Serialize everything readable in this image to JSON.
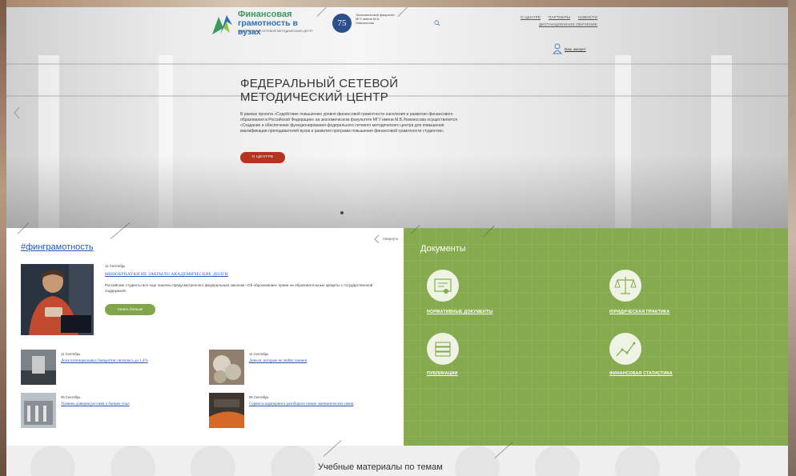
{
  "header": {
    "logo_title_line1": "Финансовая",
    "logo_title_line2": "грамотность в вузах",
    "logo_subtitle": "ФЕДЕРАЛЬНЫЙ СЕТЕВОЙ МЕТОДИЧЕСКИЙ ЦЕНТР",
    "badge_number": "75",
    "badge_text": "Экономический факультет МГУ имени М.В. Ломоносова",
    "nav": [
      "О ЦЕНТРЕ",
      "ПАРТНЕРЫ",
      "НОВОСТИ",
      "ДИСТАНЦИОННОЕ ОБУЧЕНИЕ"
    ],
    "account_label": "Ваш аккаунт"
  },
  "hero": {
    "title_line1": "ФЕДЕРАЛЬНЫЙ СЕТЕВОЙ",
    "title_line2": "МЕТОДИЧЕСКИЙ ЦЕНТР",
    "text": "В рамках проекта «Содействие повышению уровня финансовой грамотности населения и развитию финансового образования в Российской Федерации» на экономическом факультете МГУ имени М.В.Ломоносова осуществляется «Создание и обеспечение функционирования федерального сетевого методического центра для повышения квалификации преподавателей вузов и развития программ повышения финансовой грамотности студентов».",
    "button_label": "О ЦЕНТРЕ",
    "slide_count": 10,
    "active_slide": 1
  },
  "news": {
    "section_title": "#финграмотность",
    "collapse_label": "Свернуть",
    "featured": {
      "date": "11 Сентябрь",
      "title": "МИНОБРНАУКИ НЕ ЗАКРЫЛО АКАДЕМИЧЕСКИЕ ДОЛГИ",
      "text": "Российские студенты все еще лишены предусмотренного федеральным законом «Об образовании» права на образовательные кредиты с государственной поддержкой.",
      "button_label": "Узнать больше"
    },
    "items": [
      {
        "date": "11 Сентябрь",
        "title": "Доля потенциальных банкротов снизилась до 1,4%"
      },
      {
        "date": "11 Сентябрь",
        "title": "Деньги, которые не любят паники"
      },
      {
        "date": "06 Сентябрь",
        "title": "Уровень доверия россиян к банкам упал"
      },
      {
        "date": "06 Сентябрь",
        "title": "Сервисы каршеринга разобщили новые экономические связи"
      }
    ]
  },
  "documents": {
    "title": "Документы",
    "items": [
      {
        "label": "НОРМАТИВНЫЕ ДОКУМЕНТЫ",
        "icon": "certificate-icon"
      },
      {
        "label": "ЮРИДИЧЕСКАЯ ПРАКТИКА",
        "icon": "scales-icon"
      },
      {
        "label": "ПУБЛИКАЦИИ",
        "icon": "books-icon"
      },
      {
        "label": "ФИНАНСОВАЯ СТАТИСТИКА",
        "icon": "chart-icon"
      }
    ]
  },
  "materials": {
    "title": "Учебные материалы по темам"
  },
  "colors": {
    "accent_red": "#b4351f",
    "green_panel": "#86ab4f",
    "green_button": "#82a54b",
    "link_blue": "#2a57a5"
  }
}
